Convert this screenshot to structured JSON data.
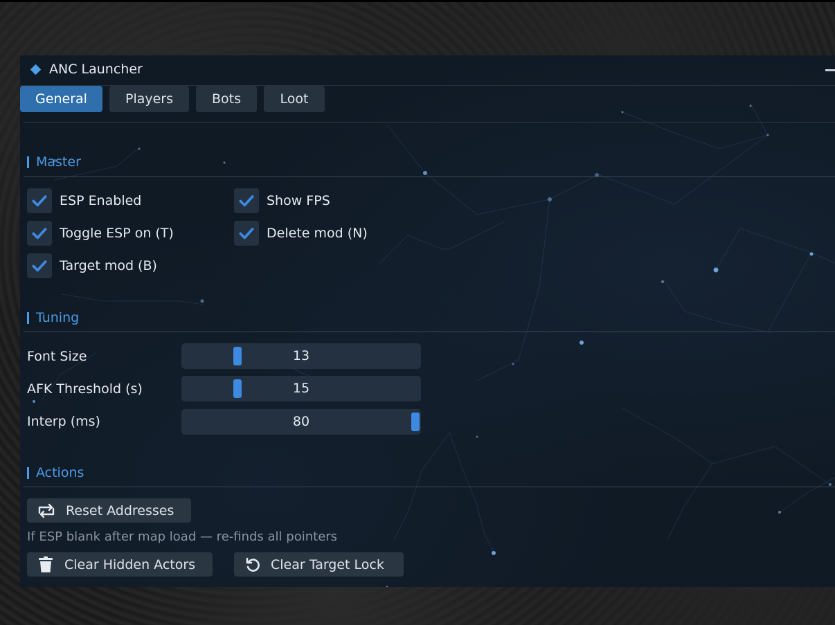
{
  "window": {
    "title": "ANC Launcher"
  },
  "tabs": [
    {
      "label": "General",
      "active": true
    },
    {
      "label": "Players",
      "active": false
    },
    {
      "label": "Bots",
      "active": false
    },
    {
      "label": "Loot",
      "active": false
    }
  ],
  "sections": {
    "master": "Master",
    "tuning": "Tuning",
    "actions": "Actions"
  },
  "master": {
    "checkboxes": [
      {
        "label": "ESP Enabled",
        "checked": true
      },
      {
        "label": "Show FPS",
        "checked": true
      },
      {
        "label": "Toggle ESP on (T)",
        "checked": true
      },
      {
        "label": "Delete mod (N)",
        "checked": true
      },
      {
        "label": "Target mod (B)",
        "checked": true
      }
    ]
  },
  "tuning": {
    "sliders": [
      {
        "label": "Font Size",
        "value": "13",
        "fraction": 0.22
      },
      {
        "label": "AFK Threshold (s)",
        "value": "15",
        "fraction": 0.22
      },
      {
        "label": "Interp (ms)",
        "value": "80",
        "fraction": 1.0
      }
    ]
  },
  "actions": {
    "reset_button": "Reset Addresses",
    "hint": "If ESP blank after map load — re-finds all pointers",
    "clear_hidden_button": "Clear Hidden Actors",
    "clear_target_button": "Clear Target Lock"
  },
  "colors": {
    "accent": "#4b9ae6",
    "tab_active": "#2f6fad",
    "window_bg": "#101a25",
    "control_bg": "#243140"
  },
  "icons": {
    "title": "diamond-icon",
    "check": "checkmark-icon",
    "reset": "swap-arrows-icon",
    "clear_hidden": "trash-icon",
    "clear_target": "undo-icon"
  }
}
